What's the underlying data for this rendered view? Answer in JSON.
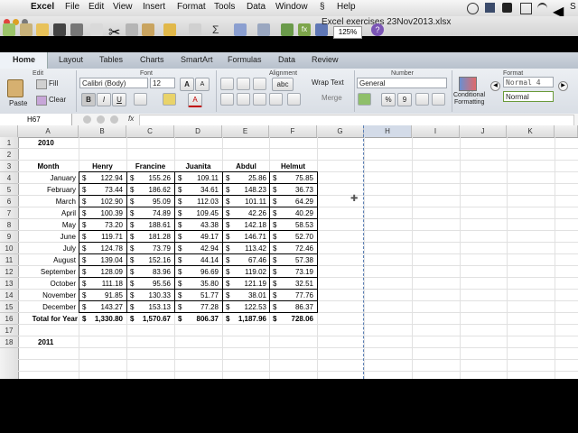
{
  "menubar": {
    "app": "Excel",
    "items": [
      "File",
      "Edit",
      "View",
      "Insert",
      "Format",
      "Tools",
      "Data",
      "Window",
      "Help"
    ],
    "right_clip": "S"
  },
  "toolbar": {
    "doc_title": "Excel exercises 23Nov2013.xlsx",
    "zoom": "125%"
  },
  "ribbon": {
    "tabs": [
      "Home",
      "Layout",
      "Tables",
      "Charts",
      "SmartArt",
      "Formulas",
      "Data",
      "Review"
    ],
    "groups": {
      "edit": "Edit",
      "font": "Font",
      "alignment": "Alignment",
      "number": "Number",
      "format": "Format"
    },
    "fill_label": "Fill",
    "clear_label": "Clear",
    "paste_label": "Paste",
    "font_name": "Calibri (Body)",
    "font_size": "12",
    "bold": "B",
    "italic": "I",
    "underline": "U",
    "font_grow": "A",
    "font_shrink": "A",
    "font_color": "A",
    "abc": "abc",
    "wrap_text": "Wrap Text",
    "merge": "Merge",
    "number_format": "General",
    "percent": "%",
    "comma": "9",
    "conditional_formatting": [
      "Conditional",
      "Formatting"
    ],
    "styles": [
      "Normal 4",
      "Normal"
    ]
  },
  "formula_bar": {
    "name_box": "H67",
    "fx": "fx",
    "content": ""
  },
  "sheet": {
    "columns": [
      "A",
      "B",
      "C",
      "D",
      "E",
      "F",
      "G",
      "H",
      "I",
      "J",
      "K"
    ],
    "selected_column": "H",
    "rows": [
      "1",
      "2",
      "3",
      "4",
      "5",
      "6",
      "7",
      "8",
      "9",
      "10",
      "11",
      "12",
      "13",
      "14",
      "15",
      "16",
      "17",
      "18"
    ],
    "year_2010": "2010",
    "year_2011": "2011",
    "headers": [
      "Month",
      "Henry",
      "Francine",
      "Juanita",
      "Abdul",
      "Helmut"
    ],
    "data": [
      [
        "January",
        "122.94",
        "155.26",
        "109.11",
        "25.86",
        "75.85"
      ],
      [
        "February",
        "73.44",
        "186.62",
        "34.61",
        "148.23",
        "36.73"
      ],
      [
        "March",
        "102.90",
        "95.09",
        "112.03",
        "101.11",
        "64.29"
      ],
      [
        "April",
        "100.39",
        "74.89",
        "109.45",
        "42.26",
        "40.29"
      ],
      [
        "May",
        "73.20",
        "188.61",
        "43.38",
        "142.18",
        "58.53"
      ],
      [
        "June",
        "119.71",
        "181.28",
        "49.17",
        "146.71",
        "52.70"
      ],
      [
        "July",
        "124.78",
        "73.79",
        "42.94",
        "113.42",
        "72.46"
      ],
      [
        "August",
        "139.04",
        "152.16",
        "44.14",
        "67.46",
        "57.38"
      ],
      [
        "September",
        "128.09",
        "83.96",
        "96.69",
        "119.02",
        "73.19"
      ],
      [
        "October",
        "111.18",
        "95.56",
        "35.80",
        "121.19",
        "32.51"
      ],
      [
        "November",
        "91.85",
        "130.33",
        "51.77",
        "38.01",
        "77.76"
      ],
      [
        "December",
        "143.27",
        "153.13",
        "77.28",
        "122.53",
        "86.37"
      ]
    ],
    "total": [
      "Total for Year",
      "1,330.80",
      "1,570.67",
      "806.37",
      "1,187.96",
      "728.06"
    ],
    "currency_symbol": "$"
  }
}
